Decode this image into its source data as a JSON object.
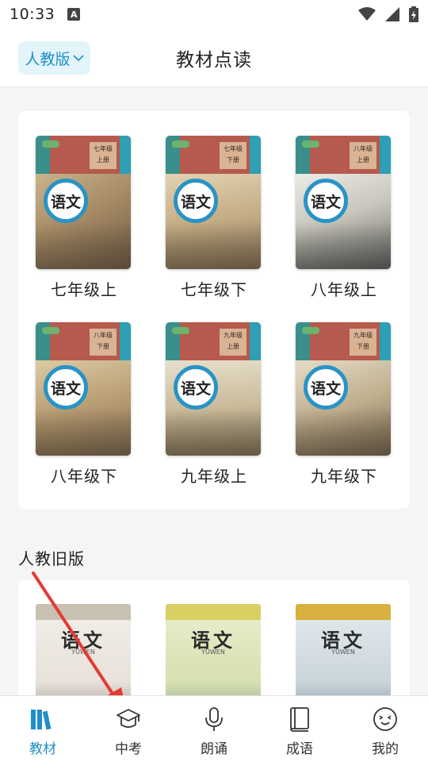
{
  "status_bar": {
    "time": "10:33",
    "notification_letter": "A"
  },
  "header": {
    "version_label": "人教版",
    "title": "教材点读"
  },
  "books": [
    {
      "label": "七年级上",
      "grade": "七年级",
      "volume": "上册",
      "subject": "语文"
    },
    {
      "label": "七年级下",
      "grade": "七年级",
      "volume": "下册",
      "subject": "语文"
    },
    {
      "label": "八年级上",
      "grade": "八年级",
      "volume": "上册",
      "subject": "语文"
    },
    {
      "label": "八年级下",
      "grade": "八年级",
      "volume": "下册",
      "subject": "语文"
    },
    {
      "label": "九年级上",
      "grade": "九年级",
      "volume": "上册",
      "subject": "语文"
    },
    {
      "label": "九年级下",
      "grade": "九年级",
      "volume": "下册",
      "subject": "语文"
    }
  ],
  "old_section": {
    "title": "人教旧版",
    "books": [
      {
        "subject": "语文",
        "subtitle": "YUWEN"
      },
      {
        "subject": "语文",
        "subtitle": "YUWEN"
      },
      {
        "subject": "语文",
        "subtitle": "YUWEN"
      }
    ]
  },
  "tabs": [
    {
      "label": "教材",
      "icon": "books-icon",
      "active": true
    },
    {
      "label": "中考",
      "icon": "graduation-cap-icon",
      "active": false
    },
    {
      "label": "朗诵",
      "icon": "microphone-icon",
      "active": false
    },
    {
      "label": "成语",
      "icon": "book-icon",
      "active": false
    },
    {
      "label": "我的",
      "icon": "smiley-icon",
      "active": false
    }
  ],
  "colors": {
    "accent": "#1f8fc8",
    "annotation_arrow": "#e53935"
  }
}
